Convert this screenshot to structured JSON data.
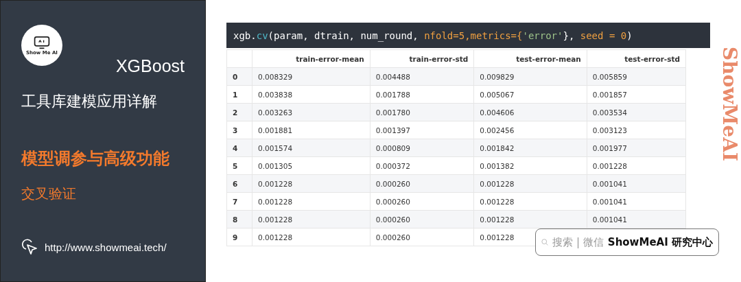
{
  "sidebar": {
    "logo_text": "Show Me AI",
    "title": "XGBoost",
    "subtitle": "工具库建模应用详解",
    "section": "模型调参与高级功能",
    "topic": "交叉验证",
    "url": "http://www.showmeai.tech/"
  },
  "code": [
    {
      "text": "xgb.",
      "color": "#ffffff"
    },
    {
      "text": "cv",
      "color": "#4fb8c8"
    },
    {
      "text": "(param, dtrain, num_round, ",
      "color": "#ffffff"
    },
    {
      "text": "nfold=5,metrics={",
      "color": "#f0a040"
    },
    {
      "text": "'error'",
      "color": "#9ec48a"
    },
    {
      "text": "}, ",
      "color": "#ffffff"
    },
    {
      "text": "seed = 0",
      "color": "#f0a040"
    },
    {
      "text": ")",
      "color": "#ffffff"
    }
  ],
  "table": {
    "columns": [
      "",
      "train-error-mean",
      "train-error-std",
      "test-error-mean",
      "test-error-std"
    ],
    "rows": [
      [
        "0",
        "0.008329",
        "0.004488",
        "0.009829",
        "0.005859"
      ],
      [
        "1",
        "0.003838",
        "0.001788",
        "0.005067",
        "0.001857"
      ],
      [
        "2",
        "0.003263",
        "0.001780",
        "0.004606",
        "0.003534"
      ],
      [
        "3",
        "0.001881",
        "0.001397",
        "0.002456",
        "0.003123"
      ],
      [
        "4",
        "0.001574",
        "0.000809",
        "0.001842",
        "0.001977"
      ],
      [
        "5",
        "0.001305",
        "0.000372",
        "0.001382",
        "0.001228"
      ],
      [
        "6",
        "0.001228",
        "0.000260",
        "0.001228",
        "0.001041"
      ],
      [
        "7",
        "0.001228",
        "0.000260",
        "0.001228",
        "0.001041"
      ],
      [
        "8",
        "0.001228",
        "0.000260",
        "0.001228",
        "0.001041"
      ],
      [
        "9",
        "0.001228",
        "0.000260",
        "0.001228",
        ""
      ]
    ]
  },
  "brand_vertical": "ShowMeAI",
  "search_badge": {
    "hint": "搜索 | 微信",
    "name": "ShowMeAI 研究中心"
  }
}
